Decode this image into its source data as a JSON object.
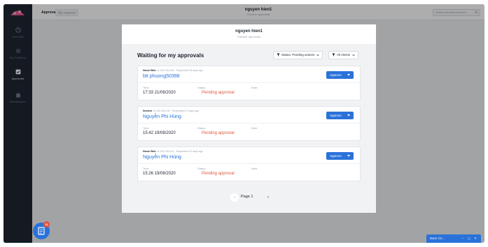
{
  "sidebar": {
    "items": [
      {
        "label": "Overview",
        "icon": "clock-icon"
      },
      {
        "label": "My Positions",
        "icon": "gear-icon"
      },
      {
        "label": "Approvals",
        "icon": "check-square-icon"
      },
      {
        "label": "Maintenance",
        "icon": "building-icon"
      }
    ],
    "active_index": 2
  },
  "header": {
    "tabs": [
      "Approvals",
      "My request"
    ],
    "user_name": "nguyen hien1",
    "user_subtitle": "Checker approvals",
    "search_placeholder": "Search pending checker..."
  },
  "modal": {
    "title": "nguyen hien1",
    "subtitle": "Checker approvals",
    "section_title": "Waiting for my approvals",
    "filters": {
      "status": "Status: Pending actions",
      "clients": "All clients"
    },
    "field_labels": {
      "time": "Time",
      "status": "Status",
      "note": "Note"
    },
    "approve_label": "Approve",
    "approvals": [
      {
        "source": "Hanoi Web",
        "ip": "14.232.245.148",
        "requested": "Requested 28 days ago",
        "name": "btt phuong50398",
        "time": "17:33 21/08/2020",
        "status": "Pending approval",
        "note": ""
      },
      {
        "source": "Nextest",
        "ip": "14.232.245.143",
        "requested": "Requested 27 days ago",
        "name": "Nguyễn Phi Hùng",
        "time": "15:42 19/08/2020",
        "status": "Pending approval",
        "note": ""
      },
      {
        "source": "Hanoi Web",
        "ip": "14.232.245.141",
        "requested": "Requested 32 days ago",
        "name": "Nguyễn Phi Hùng",
        "time": "15:26 19/08/2020",
        "status": "Pending approval",
        "note": ""
      }
    ],
    "pagination": {
      "label": "Page 1",
      "prev": "‹",
      "next": "›"
    }
  },
  "fab_badge": "11",
  "chat_bubble": {
    "label": "Base Gri...",
    "controls": "– ▢ ✕"
  },
  "colors": {
    "accent": "#2a72d9",
    "pending": "#e2553f",
    "sidebar": "#1f2733"
  }
}
